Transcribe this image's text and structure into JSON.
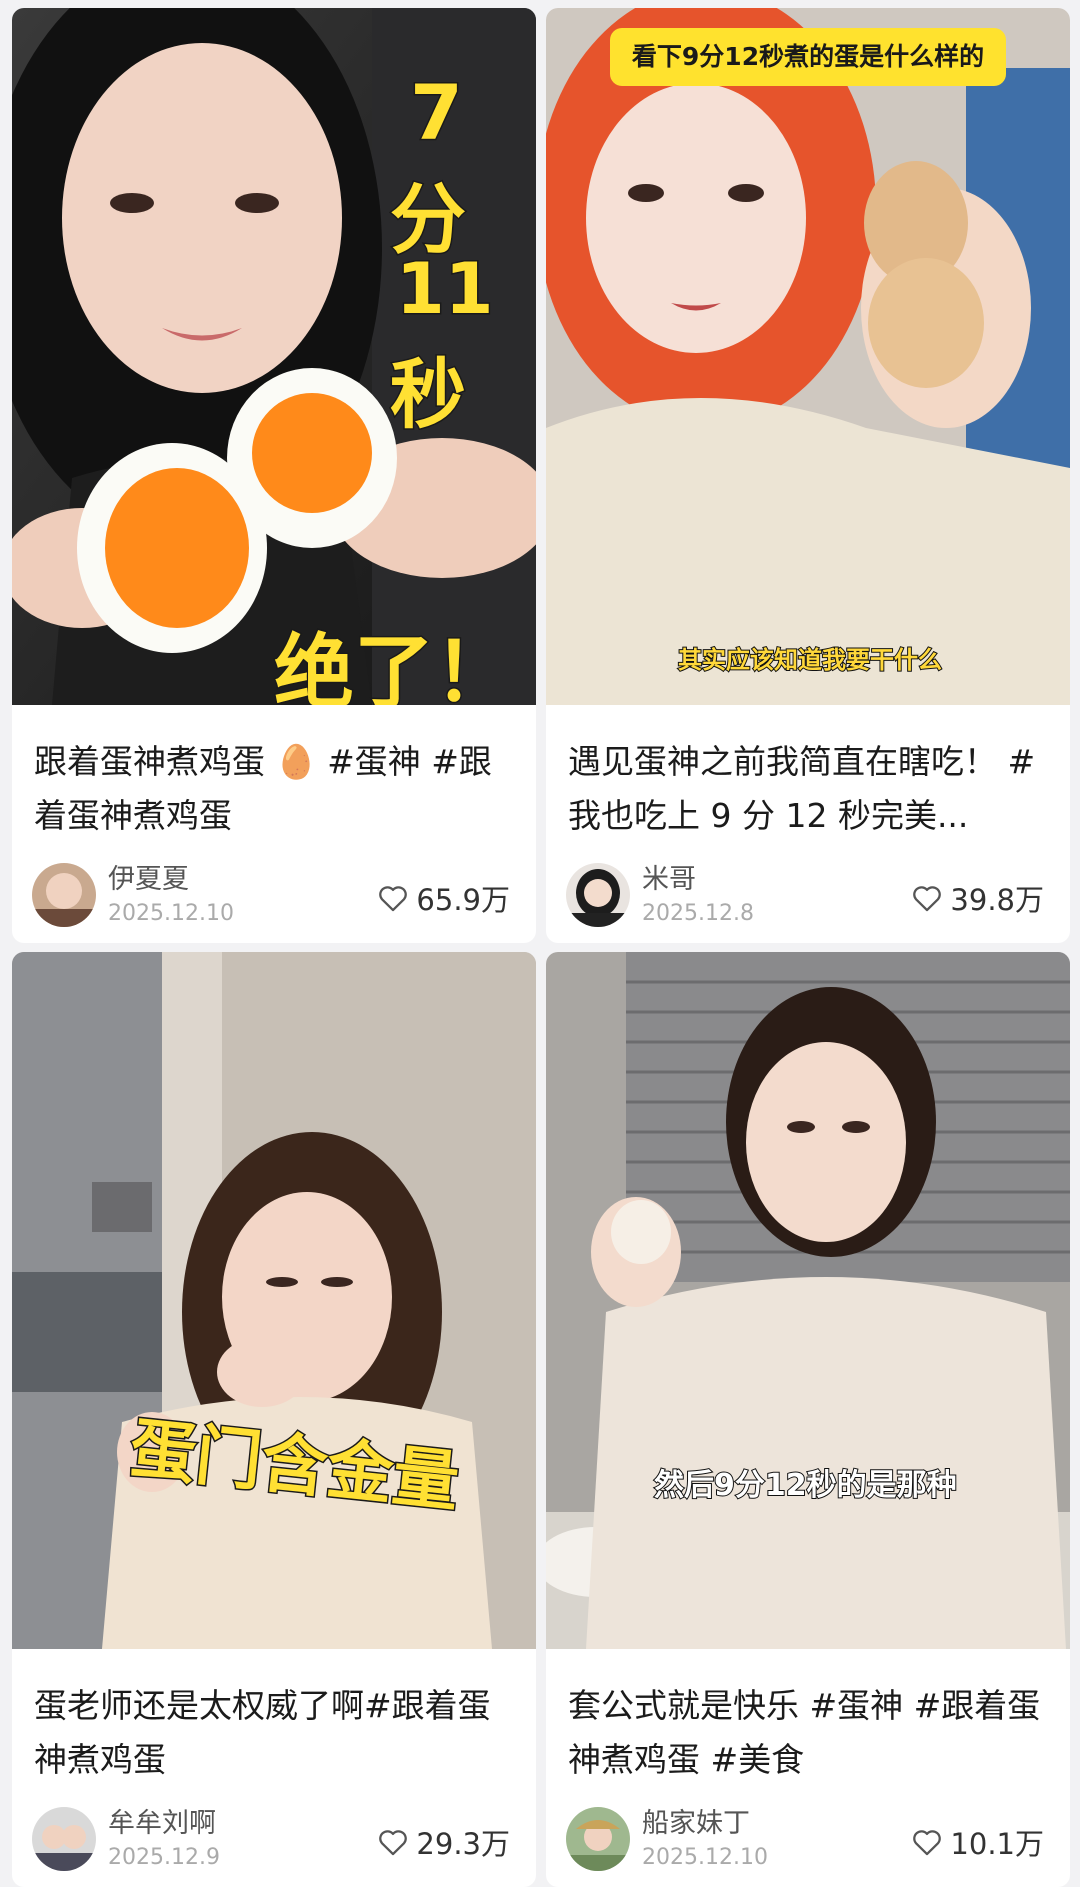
{
  "cards": [
    {
      "title": "跟着蛋神煮鸡蛋 🥚 #蛋神 #跟着蛋神煮鸡蛋",
      "author": "伊夏夏",
      "date": "2025.12.10",
      "likes": "65.9万",
      "overlay": {
        "line1": "7",
        "line2": "分",
        "line3": "11",
        "line4": "秒",
        "bottom": "绝了！"
      }
    },
    {
      "title": "遇见蛋神之前我简直在瞎吃！ #我也吃上 9 分 12 秒完美...",
      "author": "米哥",
      "date": "2025.12.8",
      "likes": "39.8万",
      "overlay": {
        "top": "看下9分12秒煮的蛋是什么样的",
        "subtitle": "其实应该知道我要干什么"
      }
    },
    {
      "title": "蛋老师还是太权威了啊#跟着蛋神煮鸡蛋",
      "author": "牟牟刘啊",
      "date": "2025.12.9",
      "likes": "29.3万",
      "overlay": {
        "center": "蛋门含金量"
      }
    },
    {
      "title": "套公式就是快乐 #蛋神 #跟着蛋神煮鸡蛋 #美食",
      "author": "船家妹丁",
      "date": "2025.12.10",
      "likes": "10.1万",
      "overlay": {
        "subtitle": "然后9分12秒的是那种"
      }
    }
  ],
  "icons": {
    "like": "heart-outline-icon"
  },
  "colors": {
    "background": "#f2f2f4",
    "card": "#ffffff",
    "caption_yellow": "#ffe033"
  }
}
